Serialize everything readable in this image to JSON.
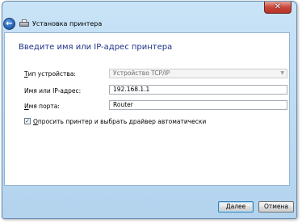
{
  "window": {
    "title": "Установка принтера",
    "close_glyph": "✕",
    "back_glyph": "←"
  },
  "main": {
    "heading": "Введите имя или IP-адрес принтера",
    "fields": [
      {
        "label_first": "Т",
        "label_rest": "ип устройства:",
        "value": "Устройство TCP/IP",
        "disabled": true
      },
      {
        "label_first": "",
        "label_rest": "Имя или IP-адрес:",
        "value": "192.168.1.1",
        "disabled": false
      },
      {
        "label_first": "И",
        "label_rest": "мя порта:",
        "value": "Router",
        "disabled": false
      }
    ],
    "checkbox": {
      "checked": true,
      "check_glyph": "✓",
      "label_first": "О",
      "label_rest": "просить принтер и выбрать драйвер автоматически"
    }
  },
  "footer": {
    "next_label": "Далее",
    "cancel_label": "Отмена"
  }
}
